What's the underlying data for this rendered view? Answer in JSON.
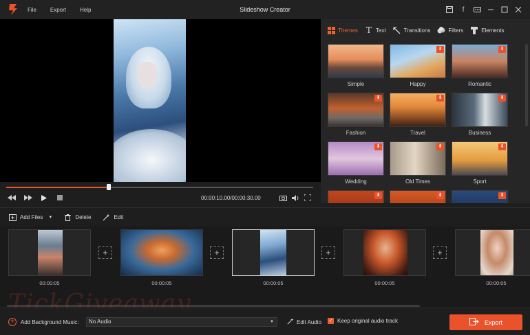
{
  "app": {
    "title": "Slideshow Creator",
    "menu": [
      "File",
      "Export",
      "Help"
    ]
  },
  "window_controls": [
    "save-icon",
    "facebook-icon",
    "feedback-icon",
    "minimize-icon",
    "maximize-icon",
    "close-icon"
  ],
  "player": {
    "time": "00:00:10.00/00:00:30.00",
    "progress_fraction": 0.333
  },
  "panel": {
    "tabs": [
      {
        "label": "Themes",
        "icon": "themes-icon",
        "active": true
      },
      {
        "label": "Text",
        "icon": "text-icon",
        "active": false
      },
      {
        "label": "Transitions",
        "icon": "transitions-icon",
        "active": false
      },
      {
        "label": "Filters",
        "icon": "filters-icon",
        "active": false
      },
      {
        "label": "Elements",
        "icon": "elements-icon",
        "active": false
      }
    ],
    "themes": [
      {
        "label": "Simple",
        "download": false
      },
      {
        "label": "Happy",
        "download": true
      },
      {
        "label": "Romantic",
        "download": true
      },
      {
        "label": "Fashion",
        "download": true
      },
      {
        "label": "Travel",
        "download": true
      },
      {
        "label": "Business",
        "download": true
      },
      {
        "label": "Wedding",
        "download": true
      },
      {
        "label": "Old Times",
        "download": true
      },
      {
        "label": "Sport",
        "download": true
      },
      {
        "label": "",
        "download": true
      },
      {
        "label": "",
        "download": true
      },
      {
        "label": "",
        "download": true
      }
    ]
  },
  "toolbar": {
    "add_files": "Add Files",
    "delete": "Delete",
    "edit": "Edit"
  },
  "clips": [
    {
      "duration": "00:00:05",
      "selected": false
    },
    {
      "duration": "00:00:05",
      "selected": false
    },
    {
      "duration": "00:00:05",
      "selected": true
    },
    {
      "duration": "00:00:05",
      "selected": false
    },
    {
      "duration": "00:00:05",
      "selected": false
    }
  ],
  "watermark": "TickGiveaway",
  "bottom": {
    "add_music_label": "Add Background Music:",
    "audio_value": "No Audio",
    "edit_audio": "Edit Audio",
    "keep_original": "Keep original audio track",
    "export": "Export"
  },
  "colors": {
    "accent": "#e9522a",
    "background": "#1e1e1e",
    "panel": "#262626"
  }
}
